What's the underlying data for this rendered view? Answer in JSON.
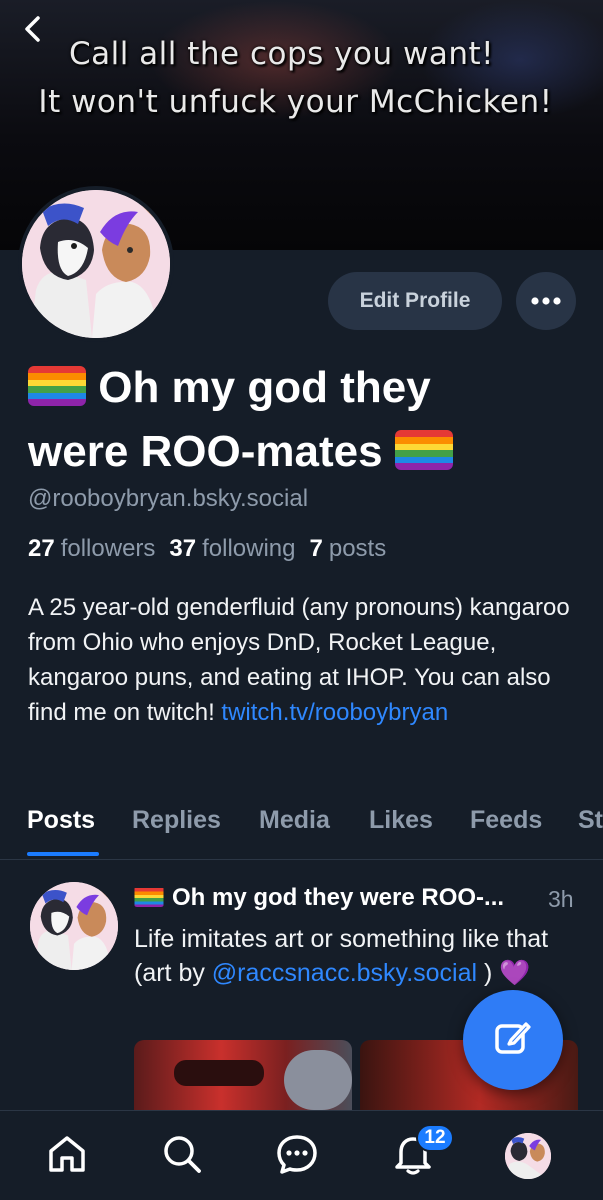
{
  "banner": {
    "line1": "Call all the cops you want!",
    "line2": "It won't unfuck your McChicken!"
  },
  "header": {
    "back_icon": "chevron-left-icon",
    "edit_profile_label": "Edit Profile",
    "more_icon": "ellipsis-icon"
  },
  "profile": {
    "display_name": "Oh my god they were ROO-mates",
    "display_name_line1": "Oh my god they",
    "display_name_line2": "were ROO-mates",
    "flag_icon": "rainbow-flag-icon",
    "handle": "@rooboybryan.bsky.social",
    "followers_count": "27",
    "followers_label": "followers",
    "following_count": "37",
    "following_label": "following",
    "posts_count": "7",
    "posts_label": "posts",
    "bio_text": "A 25 year-old genderfluid (any pronouns) kangaroo from Ohio who enjoys DnD, Rocket League, kangaroo puns, and eating at IHOP. You can also find me on twitch! ",
    "bio_link": "twitch.tv/rooboybryan"
  },
  "tabs": [
    {
      "label": "Posts",
      "active": true
    },
    {
      "label": "Replies",
      "active": false
    },
    {
      "label": "Media",
      "active": false
    },
    {
      "label": "Likes",
      "active": false
    },
    {
      "label": "Feeds",
      "active": false
    },
    {
      "label": "St",
      "active": false
    }
  ],
  "post": {
    "author": "Oh my god they were ROO-...",
    "time": "3h",
    "text_before": "Life imitates art or something like that (art by ",
    "mention": "@raccsnacc.bsky.social",
    "text_after": " ) ",
    "emoji": "💜"
  },
  "fab": {
    "icon": "compose-icon"
  },
  "bottom_nav": {
    "items": [
      "home-icon",
      "search-icon",
      "chat-icon",
      "bell-icon",
      "profile-avatar"
    ],
    "notification_count": "12"
  },
  "colors": {
    "background": "#151d28",
    "accent": "#1b7cff",
    "link": "#2f88ff",
    "button_bg": "#283446",
    "muted_text": "#8e9bab"
  }
}
